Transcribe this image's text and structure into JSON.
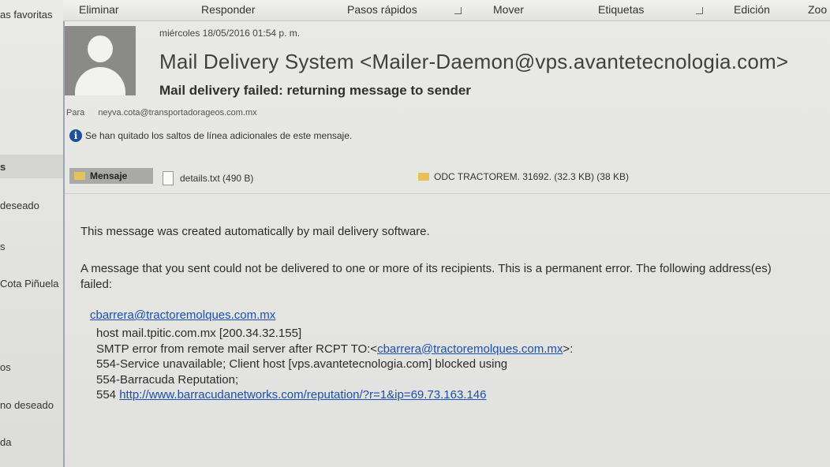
{
  "left_pane": {
    "items": [
      "as favoritas",
      "s",
      "deseado",
      "s",
      "Cota Piñuela",
      "os",
      "no deseado",
      "da"
    ]
  },
  "ribbon": {
    "eliminar": "Eliminar",
    "responder": "Responder",
    "pasos_rapidos": "Pasos rápidos",
    "mover": "Mover",
    "etiquetas": "Etiquetas",
    "edicion": "Edición",
    "zoom": "Zoo"
  },
  "message": {
    "date": "miércoles 18/05/2016 01:54 p. m.",
    "sender": "Mail Delivery System <Mailer-Daemon@vps.avantetecnologia.com>",
    "subject": "Mail delivery failed: returning message to sender",
    "to_label": "Para",
    "to_value": "neyva.cota@transportadorageos.com.mx",
    "info": "Se han quitado los saltos de línea adicionales de este mensaje.",
    "info_icon": "info-icon"
  },
  "attachments": {
    "message_tab": "Mensaje",
    "details": "details.txt (490 B)",
    "odc": "ODC TRACTOREM. 31692. (32.3 KB) (38 KB)"
  },
  "body": {
    "line1": "This message was created automatically by mail delivery software.",
    "line2": "A message that you sent could not be delivered to one or more of its recipients. This is a permanent error. The following address(es) failed:",
    "recipient": "cbarrera@tractoremolques.com.mx",
    "host": "host mail.tpitic.com.mx [200.34.32.155]",
    "smtp_prefix": "SMTP error from remote mail server after RCPT TO:<",
    "smtp_email": "cbarrera@tractoremolques.com.mx",
    "smtp_suffix": ">:",
    "line554a": "554-Service unavailable; Client host [vps.avantetecnologia.com] blocked using",
    "line554b": "554-Barracuda Reputation;",
    "line554c_prefix": "554 ",
    "reputation_url": "http://www.barracudanetworks.com/reputation/?r=1&ip=69.73.163.146"
  },
  "colors": {
    "link": "#1b4fb0",
    "info_icon": "#1f4f99",
    "envelope": "#e7c15a"
  }
}
